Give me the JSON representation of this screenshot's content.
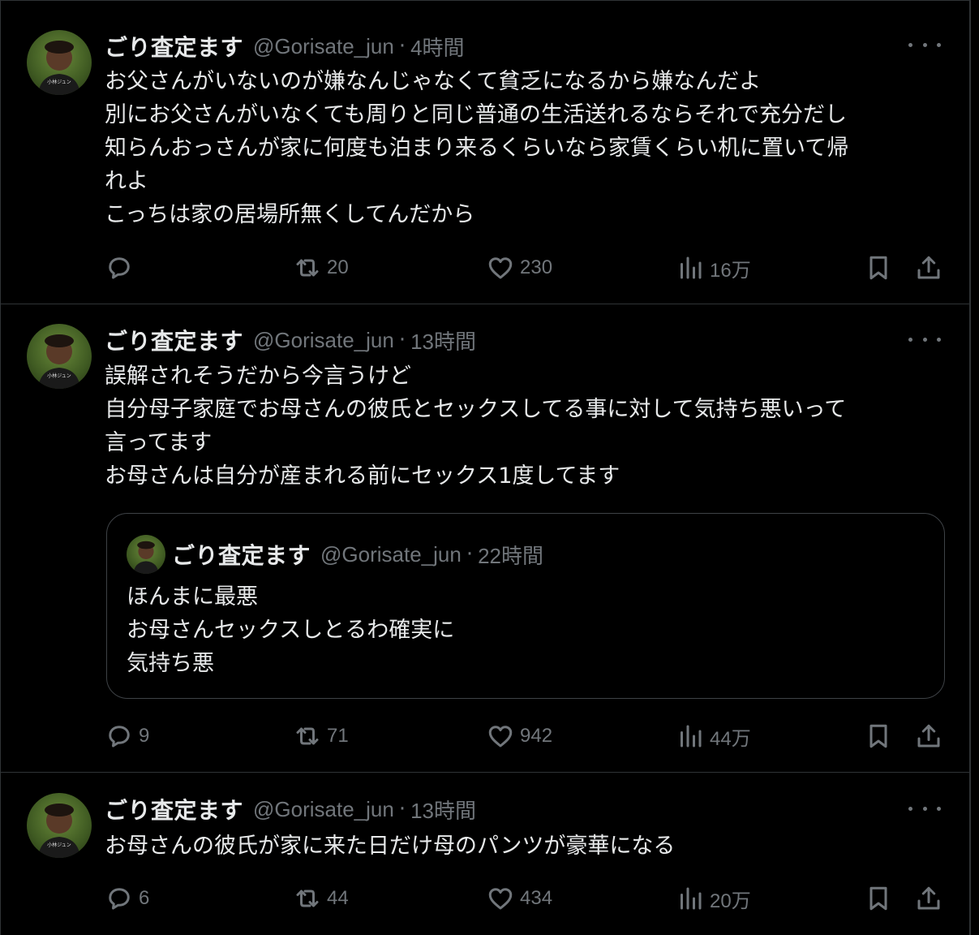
{
  "tweets": [
    {
      "name": "ごり査定ます",
      "handle": "@Gorisate_jun",
      "time": "4時間",
      "lines": [
        "お父さんがいないのが嫌なんじゃなくて貧乏になるから嫌なんだよ",
        "別にお父さんがいなくても周りと同じ普通の生活送れるならそれで充分だし",
        "知らんおっさんが家に何度も泊まり来るくらいなら家賃くらい机に置いて帰",
        "れよ",
        "こっちは家の居場所無くしてんだから"
      ],
      "replies": "",
      "retweets": "20",
      "likes": "230",
      "views": "16万"
    },
    {
      "name": "ごり査定ます",
      "handle": "@Gorisate_jun",
      "time": "13時間",
      "lines": [
        "誤解されそうだから今言うけど",
        "自分母子家庭でお母さんの彼氏とセックスしてる事に対して気持ち悪いって",
        "言ってます",
        "お母さんは自分が産まれる前にセックス1度してます"
      ],
      "quote": {
        "name": "ごり査定ます",
        "handle": "@Gorisate_jun",
        "time": "22時間",
        "lines": [
          "ほんまに最悪",
          "お母さんセックスしとるわ確実に",
          "気持ち悪"
        ]
      },
      "replies": "9",
      "retweets": "71",
      "likes": "942",
      "views": "44万"
    },
    {
      "name": "ごり査定ます",
      "handle": "@Gorisate_jun",
      "time": "13時間",
      "lines": [
        "お母さんの彼氏が家に来た日だけ母のパンツが豪華になる"
      ],
      "replies": "6",
      "retweets": "44",
      "likes": "434",
      "views": "20万"
    }
  ],
  "separator": "·",
  "icons": {
    "reply": "reply-icon",
    "retweet": "retweet-icon",
    "like": "heart-icon",
    "views": "views-chart-icon",
    "bookmark": "bookmark-icon",
    "share": "share-icon",
    "more": "more-dots-icon"
  },
  "colors": {
    "background": "#000000",
    "text": "#e7e9ea",
    "muted": "#71767b",
    "border": "#2f3336"
  }
}
